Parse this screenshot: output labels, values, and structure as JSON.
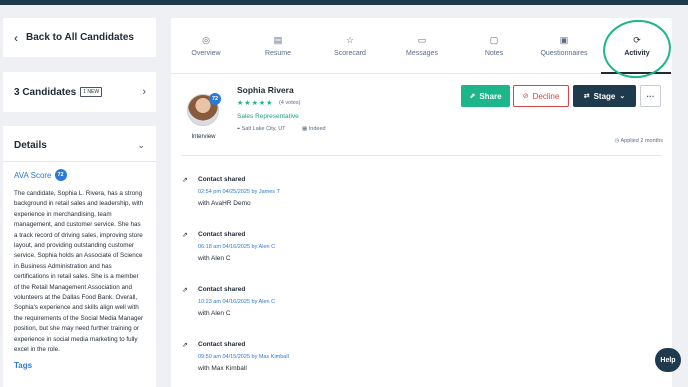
{
  "nav": {
    "back_label": "Back to All Candidates",
    "candidates_label": "3 Candidates",
    "new_badge": "1 NEW"
  },
  "details": {
    "title": "Details",
    "ava_label": "AVA Score",
    "ava_score": "72",
    "summary": "The candidate, Sophia L. Rivera, has a strong background in retail sales and leadership, with experience in merchandising, team management, and customer service. She has a track record of driving sales, improving store layout, and providing outstanding customer service. Sophia holds an Associate of Science in Business Administration and has certifications in retail sales. She is a member of the Retail Management Association and volunteers at the Dallas Food Bank. Overall, Sophia's experience and skills align well with the requirements of the Social Media Manager position, but she may need further training or experience in social media marketing to fully excel in the role.",
    "next_section": "Tags"
  },
  "tabs": [
    {
      "label": "Overview",
      "icon": "user-circle-icon"
    },
    {
      "label": "Resume",
      "icon": "document-icon"
    },
    {
      "label": "Scorecard",
      "icon": "star-icon"
    },
    {
      "label": "Messages",
      "icon": "chat-icon"
    },
    {
      "label": "Notes",
      "icon": "note-icon"
    },
    {
      "label": "Questionnaires",
      "icon": "clipboard-icon"
    },
    {
      "label": "Activity",
      "icon": "refresh-icon"
    }
  ],
  "active_tab": "Activity",
  "candidate": {
    "name": "Sophia Rivera",
    "score": "72",
    "stage": "Interview",
    "rating": 5,
    "votes": "(4 votes)",
    "role": "Sales Representative",
    "location": "Salt Lake City, UT",
    "source": "Indeed",
    "applied": "Applied 2 months"
  },
  "actions": {
    "share": "Share",
    "decline": "Decline",
    "stage": "Stage",
    "more": "···"
  },
  "activity": [
    {
      "title": "Contact shared",
      "meta": "02:54 pm 04/25/2025 by James T",
      "desc": "with AvaHR Demo"
    },
    {
      "title": "Contact shared",
      "meta": "06:18 am 04/16/2025 by Alen C",
      "desc": "with Alen C"
    },
    {
      "title": "Contact shared",
      "meta": "10:23 am 04/16/2025 by Alen C",
      "desc": "with Alen C"
    },
    {
      "title": "Contact shared",
      "meta": "09:50 am 04/15/2025 by Max Kimball",
      "desc": "with Max Kimball"
    }
  ],
  "help_label": "Help",
  "colors": {
    "accent_green": "#1db58a",
    "navy": "#1f3a4d",
    "link_blue": "#2b7bd6",
    "decline_red": "#d04545"
  }
}
